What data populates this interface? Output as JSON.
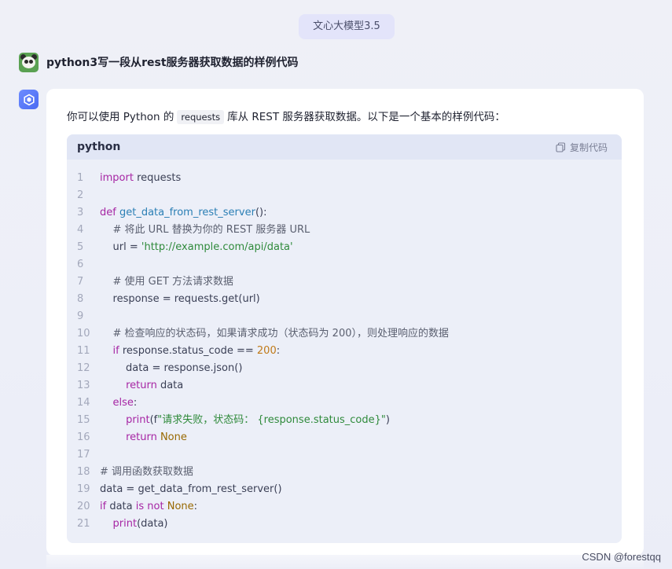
{
  "header": {
    "model_label": "文心大模型3.5"
  },
  "user_message": {
    "text": "python3写一段从rest服务器获取数据的样例代码"
  },
  "answer": {
    "intro_before": "你可以使用 Python 的",
    "intro_code": "requests",
    "intro_after": "库从 REST 服务器获取数据。以下是一个基本的样例代码："
  },
  "code_block": {
    "language": "python",
    "copy_label": "复制代码",
    "lines": [
      {
        "n": "1",
        "t": [
          [
            "import",
            "kw"
          ],
          [
            " requests",
            "tx"
          ]
        ]
      },
      {
        "n": "2",
        "t": []
      },
      {
        "n": "3",
        "t": [
          [
            "def",
            "kw"
          ],
          [
            " ",
            "tx"
          ],
          [
            "get_data_from_rest_server",
            "fn"
          ],
          [
            "():",
            "tx"
          ]
        ]
      },
      {
        "n": "4",
        "t": [
          [
            "    # 将此 URL 替换为你的 REST 服务器 URL",
            "cm"
          ]
        ]
      },
      {
        "n": "5",
        "t": [
          [
            "    url = ",
            "tx"
          ],
          [
            "'http://example.com/api/data'",
            "str"
          ]
        ]
      },
      {
        "n": "6",
        "t": []
      },
      {
        "n": "7",
        "t": [
          [
            "    # 使用 GET 方法请求数据",
            "cm"
          ]
        ]
      },
      {
        "n": "8",
        "t": [
          [
            "    response = requests.get(url)",
            "tx"
          ]
        ]
      },
      {
        "n": "9",
        "t": []
      },
      {
        "n": "10",
        "t": [
          [
            "    # 检查响应的状态码，如果请求成功（状态码为 200），则处理响应的数据",
            "cm"
          ]
        ]
      },
      {
        "n": "11",
        "t": [
          [
            "    ",
            "tx"
          ],
          [
            "if",
            "kw"
          ],
          [
            " response.status_code == ",
            "tx"
          ],
          [
            "200",
            "num"
          ],
          [
            ":",
            "tx"
          ]
        ]
      },
      {
        "n": "12",
        "t": [
          [
            "        data = response.json()",
            "tx"
          ]
        ]
      },
      {
        "n": "13",
        "t": [
          [
            "        ",
            "tx"
          ],
          [
            "return",
            "kw"
          ],
          [
            " data",
            "tx"
          ]
        ]
      },
      {
        "n": "14",
        "t": [
          [
            "    ",
            "tx"
          ],
          [
            "else",
            "kw"
          ],
          [
            ":",
            "tx"
          ]
        ]
      },
      {
        "n": "15",
        "t": [
          [
            "        ",
            "tx"
          ],
          [
            "print",
            "kw"
          ],
          [
            "(f",
            "tx"
          ],
          [
            "\"请求失败，状态码： {response.status_code}\"",
            "str"
          ],
          [
            ")",
            "tx"
          ]
        ]
      },
      {
        "n": "16",
        "t": [
          [
            "        ",
            "tx"
          ],
          [
            "return",
            "kw"
          ],
          [
            " ",
            "tx"
          ],
          [
            "None",
            "bi"
          ]
        ]
      },
      {
        "n": "17",
        "t": []
      },
      {
        "n": "18",
        "t": [
          [
            "# 调用函数获取数据",
            "cm"
          ]
        ]
      },
      {
        "n": "19",
        "t": [
          [
            "data = get_data_from_rest_server()",
            "tx"
          ]
        ]
      },
      {
        "n": "20",
        "t": [
          [
            "if",
            "kw"
          ],
          [
            " data ",
            "tx"
          ],
          [
            "is",
            "kw"
          ],
          [
            " ",
            "tx"
          ],
          [
            "not",
            "kw"
          ],
          [
            " ",
            "tx"
          ],
          [
            "None",
            "bi"
          ],
          [
            ":",
            "tx"
          ]
        ]
      },
      {
        "n": "21",
        "t": [
          [
            "    ",
            "tx"
          ],
          [
            "print",
            "kw"
          ],
          [
            "(data)",
            "tx"
          ]
        ]
      }
    ]
  },
  "watermark": {
    "text": "CSDN @forestqq"
  },
  "colors": {
    "accent": "#4b6bf2",
    "card": "#ffffff",
    "code_bg": "#eceff8"
  },
  "icons": {
    "user_avatar": "panda-avatar-icon",
    "bot_avatar": "ernie-bot-icon",
    "copy": "copy-icon"
  }
}
